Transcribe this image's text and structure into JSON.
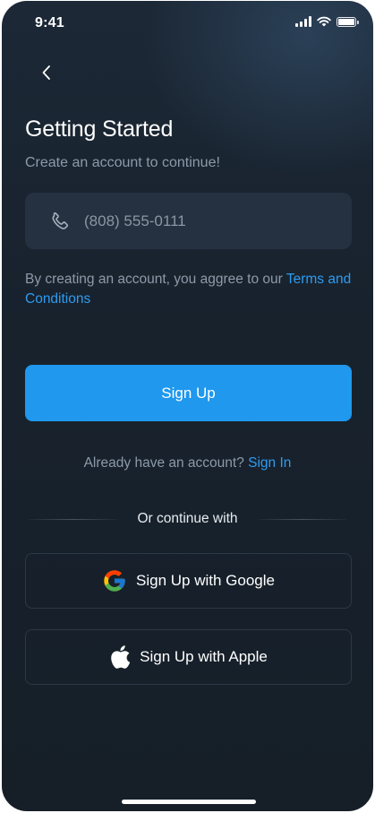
{
  "status_bar": {
    "time": "9:41",
    "icons": [
      "cellular-signal-icon",
      "wifi-icon",
      "battery-icon"
    ]
  },
  "nav": {
    "back_icon": "chevron-left-icon"
  },
  "header": {
    "title": "Getting Started",
    "subtitle": "Create an account to continue!"
  },
  "phone_input": {
    "icon": "phone-icon",
    "placeholder": "(808) 555-0111",
    "value": ""
  },
  "terms": {
    "text": "By creating an account, you aggree to our ",
    "link": "Terms and Conditions"
  },
  "signup_button": {
    "label": "Sign Up"
  },
  "signin": {
    "text": "Already have an account? ",
    "link": "Sign In"
  },
  "divider": {
    "label": "Or continue with"
  },
  "social": {
    "google": {
      "label": "Sign Up with Google",
      "icon": "google-icon"
    },
    "apple": {
      "label": "Sign Up with Apple",
      "icon": "apple-icon"
    }
  },
  "colors": {
    "background": "#18222d",
    "accent": "#1f98ee",
    "link": "#2f9bf0",
    "field_bg": "#253140",
    "muted_text": "#8d9aa8"
  }
}
